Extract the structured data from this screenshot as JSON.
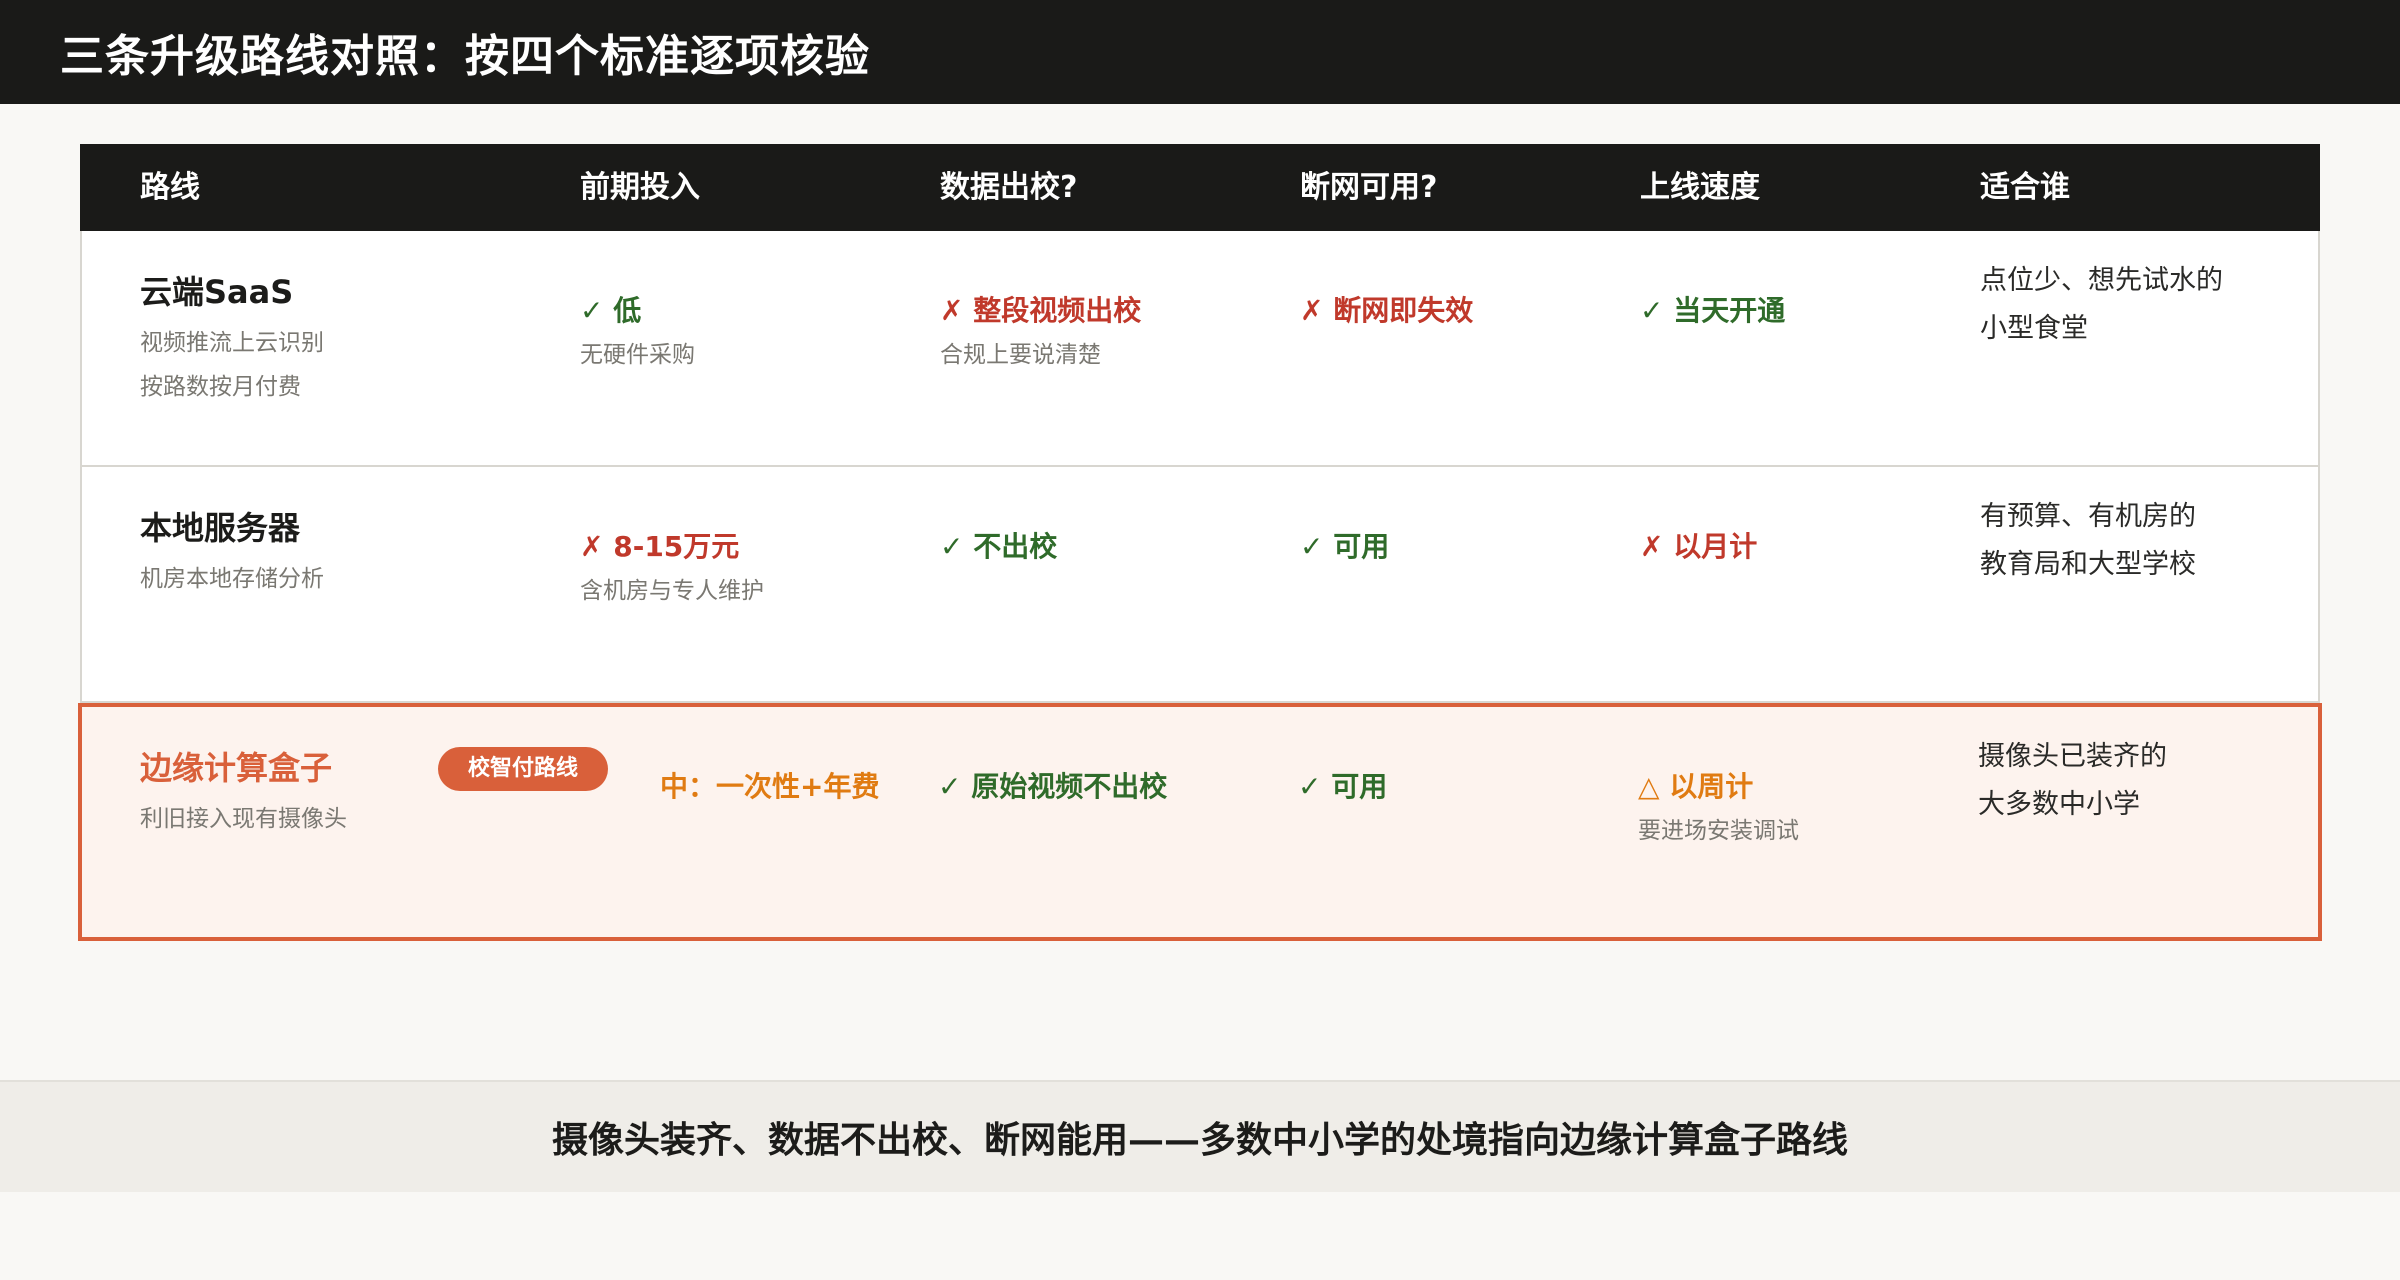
{
  "title": "三条升级路线对照：按四个标准逐项核验",
  "table": {
    "headers": [
      "路线",
      "前期投入",
      "数据出校?",
      "断网可用?",
      "上线速度",
      "适合谁"
    ],
    "rows": [
      {
        "name": "云端SaaS",
        "desc": [
          "视频推流上云识别",
          "按路数按月付费"
        ],
        "cost": {
          "mark": "✓",
          "text": "低",
          "note": "无硬件采购",
          "status": "good"
        },
        "data": {
          "mark": "✗",
          "text": "整段视频出校",
          "note": "合规上要说清楚",
          "status": "bad"
        },
        "offline": {
          "mark": "✗",
          "text": "断网即失效",
          "status": "bad"
        },
        "speed": {
          "mark": "✓",
          "text": "当天开通",
          "status": "good"
        },
        "fit": [
          "点位少、想先试水的",
          "小型食堂"
        ]
      },
      {
        "name": "本地服务器",
        "desc": [
          "机房本地存储分析"
        ],
        "cost": {
          "mark": "✗",
          "text": "8-15万元",
          "note": "含机房与专人维护",
          "status": "bad"
        },
        "data": {
          "mark": "✓",
          "text": "不出校",
          "status": "good"
        },
        "offline": {
          "mark": "✓",
          "text": "可用",
          "status": "good"
        },
        "speed": {
          "mark": "✗",
          "text": "以月计",
          "status": "bad"
        },
        "fit": [
          "有预算、有机房的",
          "教育局和大型学校"
        ]
      },
      {
        "name": "边缘计算盒子",
        "badge": "校智付路线",
        "desc": [
          "利旧接入现有摄像头"
        ],
        "cost": {
          "text": "中：一次性+年费",
          "status": "mid"
        },
        "data": {
          "mark": "✓",
          "text": "原始视频不出校",
          "status": "good"
        },
        "offline": {
          "mark": "✓",
          "text": "可用",
          "status": "good"
        },
        "speed": {
          "mark": "△",
          "text": "以周计",
          "note": "要进场安装调试",
          "status": "mid"
        },
        "fit": [
          "摄像头已装齐的",
          "大多数中小学"
        ]
      }
    ]
  },
  "footer": "摄像头装齐、数据不出校、断网能用——多数中小学的处境指向边缘计算盒子路线",
  "colors": {
    "header_bg": "#1a1a18",
    "accent": "#d9603a",
    "good": "#2f6b2a",
    "bad": "#c0392b",
    "mid": "#e07b12",
    "highlight_bg": "#fdf3ee"
  }
}
